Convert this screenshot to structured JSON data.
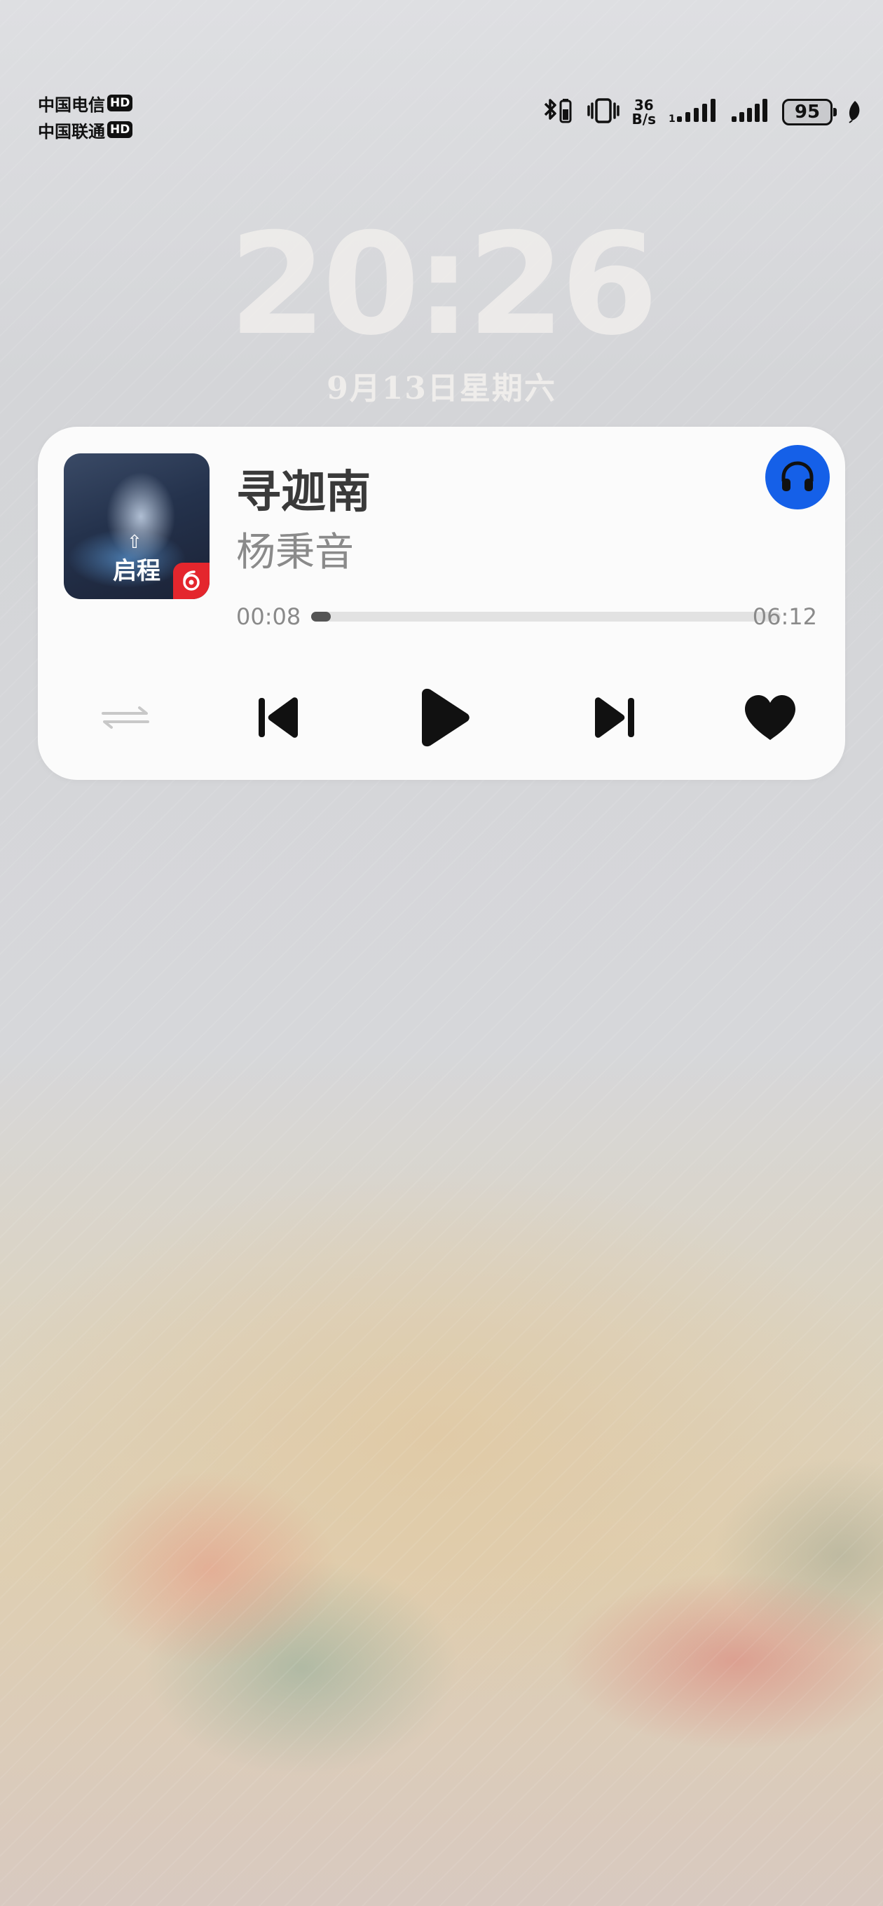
{
  "status_bar": {
    "carriers": [
      {
        "name": "中国电信",
        "badge": "HD"
      },
      {
        "name": "中国联通",
        "badge": "HD"
      }
    ],
    "network_speed_value": "36",
    "network_speed_unit": "B/s",
    "battery_level": "95",
    "icons": [
      "bluetooth-icon",
      "vibrate-icon",
      "signal-1-icon",
      "signal-2-icon",
      "battery-icon",
      "power-saving-leaf-icon"
    ]
  },
  "lockscreen": {
    "time": "20:26",
    "date": "9月13日星期六"
  },
  "music_card": {
    "album_cover_text": "启程",
    "song_title": "寻迦南",
    "artist": "杨秉音",
    "elapsed": "00:08",
    "total": "06:12",
    "progress_fraction": 0.022,
    "accent_color": "#1560e8",
    "app_badge_color": "#e4262d",
    "controls": [
      "repeat-icon",
      "previous-icon",
      "play-icon",
      "next-icon",
      "heart-icon"
    ]
  }
}
